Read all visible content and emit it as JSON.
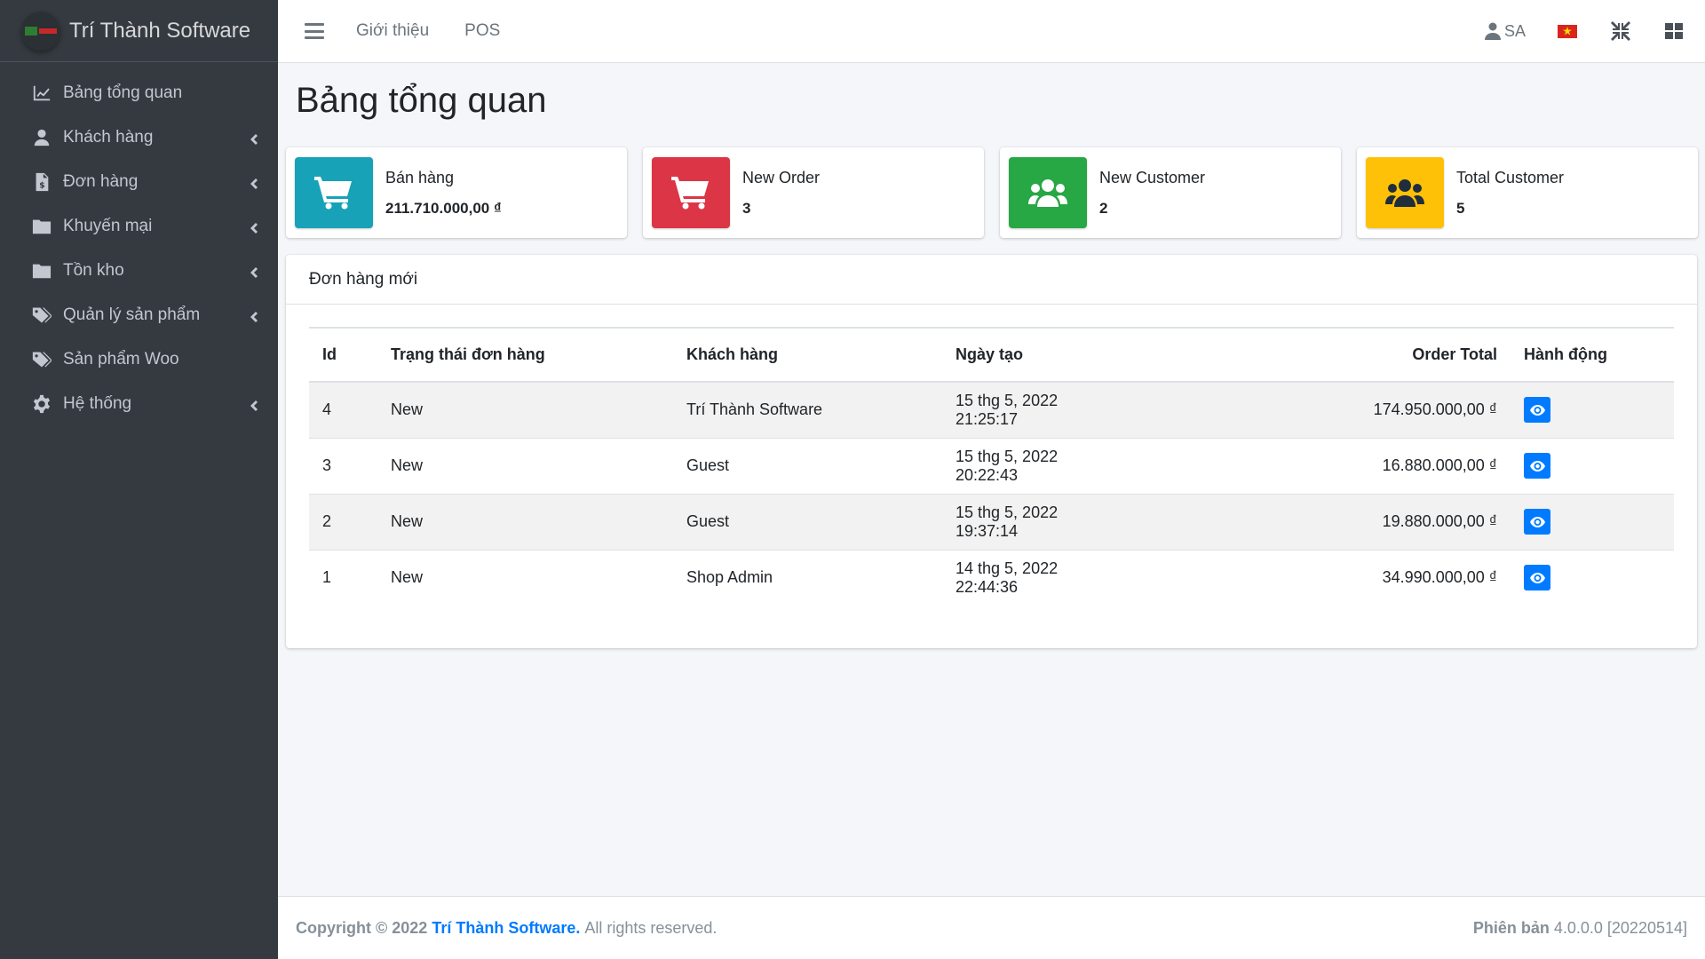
{
  "brand": {
    "name": "Trí Thành Software"
  },
  "sidebar": {
    "items": [
      {
        "label": "Bảng tổng quan",
        "icon": "chart-line-icon",
        "has_children": false
      },
      {
        "label": "Khách hàng",
        "icon": "user-icon",
        "has_children": true
      },
      {
        "label": "Đơn hàng",
        "icon": "invoice-icon",
        "has_children": true
      },
      {
        "label": "Khuyến mại",
        "icon": "folder-icon",
        "has_children": true
      },
      {
        "label": "Tồn kho",
        "icon": "folder-icon",
        "has_children": true
      },
      {
        "label": "Quản lý sản phẩm",
        "icon": "tags-icon",
        "has_children": true
      },
      {
        "label": "Sản phẩm Woo",
        "icon": "tags-icon",
        "has_children": false
      },
      {
        "label": "Hệ thống",
        "icon": "gear-icon",
        "has_children": true
      }
    ]
  },
  "topbar": {
    "links": [
      "Giới thiệu",
      "POS"
    ],
    "user": "SA"
  },
  "page": {
    "title": "Bảng tổng quan"
  },
  "stats": [
    {
      "label": "Bán hàng",
      "value": "211.710.000,00 ₫",
      "color": "#17a2b8",
      "icon": "cart-icon"
    },
    {
      "label": "New Order",
      "value": "3",
      "color": "#dc3545",
      "icon": "cart-icon"
    },
    {
      "label": "New Customer",
      "value": "2",
      "color": "#28a745",
      "icon": "users-icon"
    },
    {
      "label": "Total Customer",
      "value": "5",
      "color": "#ffc107",
      "icon": "users-icon"
    }
  ],
  "orders": {
    "title": "Đơn hàng mới",
    "columns": [
      "Id",
      "Trạng thái đơn hàng",
      "Khách hàng",
      "Ngày tạo",
      "Order Total",
      "Hành động"
    ],
    "rows": [
      {
        "id": "4",
        "status": "New",
        "customer": "Trí Thành Software",
        "date": "15 thg 5, 2022 21:25:17",
        "total": "174.950.000,00 ₫"
      },
      {
        "id": "3",
        "status": "New",
        "customer": "Guest",
        "date": "15 thg 5, 2022 20:22:43",
        "total": "16.880.000,00 ₫"
      },
      {
        "id": "2",
        "status": "New",
        "customer": "Guest",
        "date": "15 thg 5, 2022 19:37:14",
        "total": "19.880.000,00 ₫"
      },
      {
        "id": "1",
        "status": "New",
        "customer": "Shop Admin",
        "date": "14 thg 5, 2022 22:44:36",
        "total": "34.990.000,00 ₫"
      }
    ]
  },
  "footer": {
    "copyright_prefix": "Copyright © 2022",
    "company": "Trí Thành Software.",
    "rights": "All rights reserved.",
    "version_label": "Phiên bản",
    "version": "4.0.0.0 [20220514]"
  }
}
